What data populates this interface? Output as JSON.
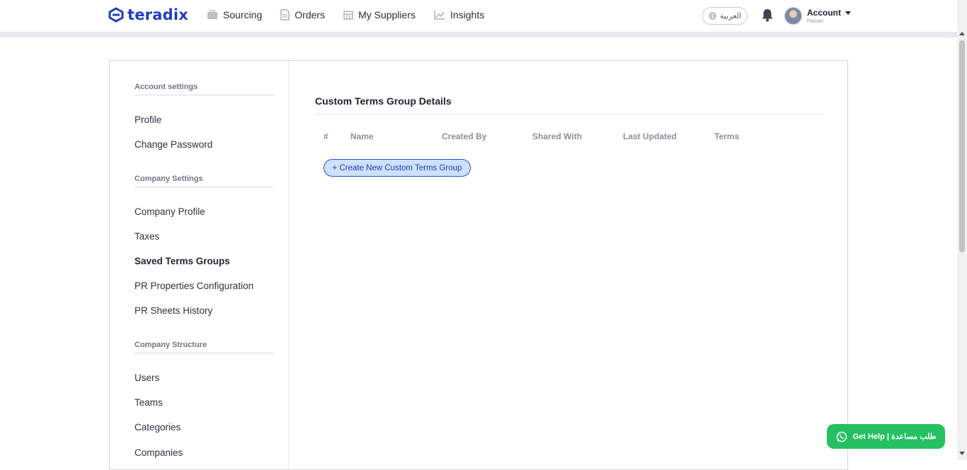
{
  "header": {
    "logo_text": "teradix",
    "nav": [
      {
        "label": "Sourcing",
        "icon": "sourcing-icon"
      },
      {
        "label": "Orders",
        "icon": "orders-icon"
      },
      {
        "label": "My Suppliers",
        "icon": "suppliers-icon"
      },
      {
        "label": "Insights",
        "icon": "insights-icon"
      }
    ],
    "language_label": "العربية",
    "account_label": "Account",
    "account_user": "Hasan"
  },
  "sidebar": {
    "sections": [
      {
        "title": "Account settings",
        "items": [
          "Profile",
          "Change Password"
        ]
      },
      {
        "title": "Company Settings",
        "items": [
          "Company Profile",
          "Taxes",
          "Saved Terms Groups",
          "PR Properties Configuration",
          "PR Sheets History"
        ]
      },
      {
        "title": "Company Structure",
        "items": [
          "Users",
          "Teams",
          "Categories",
          "Companies"
        ]
      }
    ],
    "active_item": "Saved Terms Groups"
  },
  "main": {
    "title": "Custom Terms Group Details",
    "columns": [
      "#",
      "Name",
      "Created By",
      "Shared With",
      "Last Updated",
      "Terms"
    ],
    "create_button": "+ Create New Custom Terms Group"
  },
  "help_button": "Get Help | طلب مساعدة",
  "colors": {
    "brand": "#1f3fbf",
    "accent_button_bg": "#cfe0fb",
    "help_green": "#25c062"
  }
}
